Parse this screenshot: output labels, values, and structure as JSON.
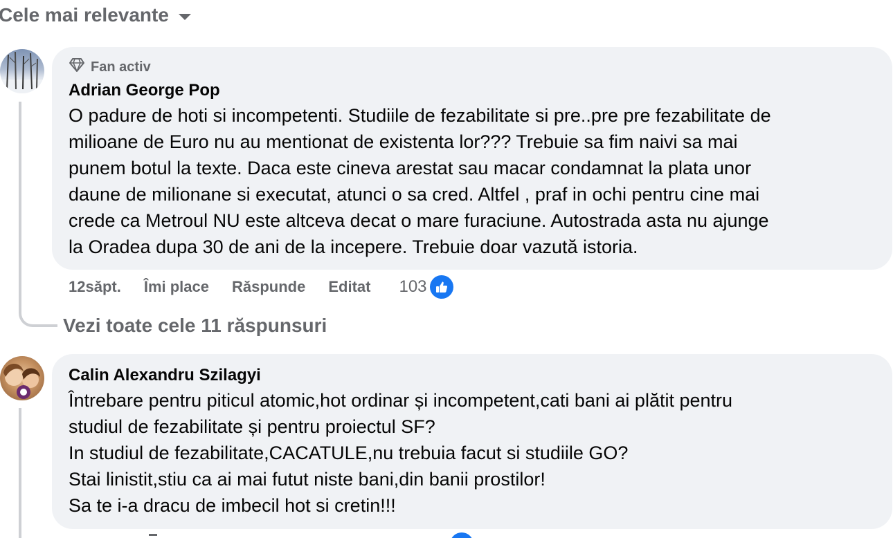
{
  "sort": {
    "label": "Cele mai relevante"
  },
  "comments": [
    {
      "badge": "Fan activ",
      "author": "Adrian George Pop",
      "lines": [
        "O padure de hoti si incompetenti. Studiile de fezabilitate si pre..pre pre fezabilitate de",
        "milioane de Euro nu au mentionat de existenta lor??? Trebuie sa fim naivi sa mai",
        "punem botul la texte. Daca este cineva arestat sau macar condamnat la plata unor",
        "daune de milionane si executat, atunci o sa cred. Altfel , praf in ochi pentru cine mai",
        "crede ca Metroul NU este altceva decat o mare furaciune. Autostrada asta nu ajunge",
        "la Oradea dupa 30 de ani de la incepere. Trebuie doar vazută istoria."
      ],
      "time": "12săpt.",
      "like_label": "Îmi place",
      "reply_label": "Răspunde",
      "edited_label": "Editat",
      "reaction_count": "103"
    },
    {
      "author": "Calin Alexandru Szilagyi",
      "lines": [
        "Întrebare pentru piticul atomic,hot ordinar și incompetent,cati bani ai plătit pentru",
        "studiul de fezabilitate și pentru proiectul SF?",
        "In studiul de fezabilitate,CACATULE,nu trebuia facut si studiile GO?",
        "Stai linistit,stiu ca ai mai futut niste bani,din banii prostilor!",
        "Sa te i-a dracu de imbecil hot si cretin!!!"
      ]
    }
  ],
  "view_replies": "Vezi toate cele 11 răspunsuri",
  "colors": {
    "bubble": "#f0f2f5",
    "secondary_text": "#65676b",
    "like_blue": "#1877f2"
  },
  "icons": {
    "sort": "chevron-down-icon",
    "badge": "diamond-icon",
    "reaction": "thumbs-up-icon"
  }
}
